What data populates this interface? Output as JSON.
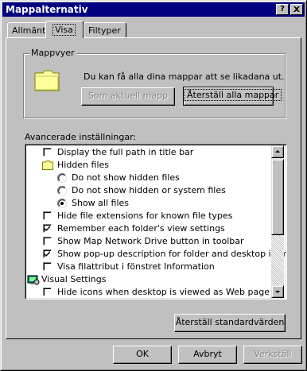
{
  "window": {
    "title": "Mappalternativ",
    "help_button": "?",
    "close_button": "×"
  },
  "tabs": [
    {
      "label": "Allmänt",
      "active": false
    },
    {
      "label": "Visa",
      "active": true
    },
    {
      "label": "Filtyper",
      "active": false
    }
  ],
  "folder_views": {
    "group_label": "Mappvyer",
    "description": "Du kan få alla dina mappar att se likadana ut.",
    "like_current_button": "Som aktuell mapp",
    "reset_all_button": "Återställ alla mappar",
    "like_current_enabled": false
  },
  "advanced": {
    "label": "Avancerade inställningar:",
    "items": [
      {
        "type": "checkbox",
        "checked": false,
        "indent": 0,
        "label": "Display the full path in title bar"
      },
      {
        "type": "folder",
        "indent": 0,
        "label": "Hidden files"
      },
      {
        "type": "radio",
        "checked": false,
        "indent": 1,
        "label": "Do not show hidden files"
      },
      {
        "type": "radio",
        "checked": false,
        "indent": 1,
        "label": "Do not show hidden or system files"
      },
      {
        "type": "radio",
        "checked": true,
        "indent": 1,
        "label": "Show all files"
      },
      {
        "type": "checkbox",
        "checked": false,
        "indent": 0,
        "label": "Hide file extensions for known file types"
      },
      {
        "type": "checkbox",
        "checked": true,
        "indent": 0,
        "label": "Remember each folder's view settings"
      },
      {
        "type": "checkbox",
        "checked": false,
        "indent": 0,
        "label": "Show Map Network Drive button in toolbar"
      },
      {
        "type": "checkbox",
        "checked": true,
        "indent": 0,
        "label": "Show pop-up description for folder and desktop items."
      },
      {
        "type": "checkbox",
        "checked": false,
        "indent": 0,
        "label": "Visa filattribut i fönstret Information"
      },
      {
        "type": "settings",
        "indent": -1,
        "label": "Visual Settings"
      },
      {
        "type": "checkbox",
        "checked": false,
        "indent": 0,
        "label": "Hide icons when desktop is viewed as Web page"
      }
    ],
    "restore_defaults_button": "Återställ standardvärden"
  },
  "footer": {
    "ok_button": "OK",
    "cancel_button": "Avbryt",
    "apply_button": "Verkställ",
    "apply_enabled": false
  }
}
